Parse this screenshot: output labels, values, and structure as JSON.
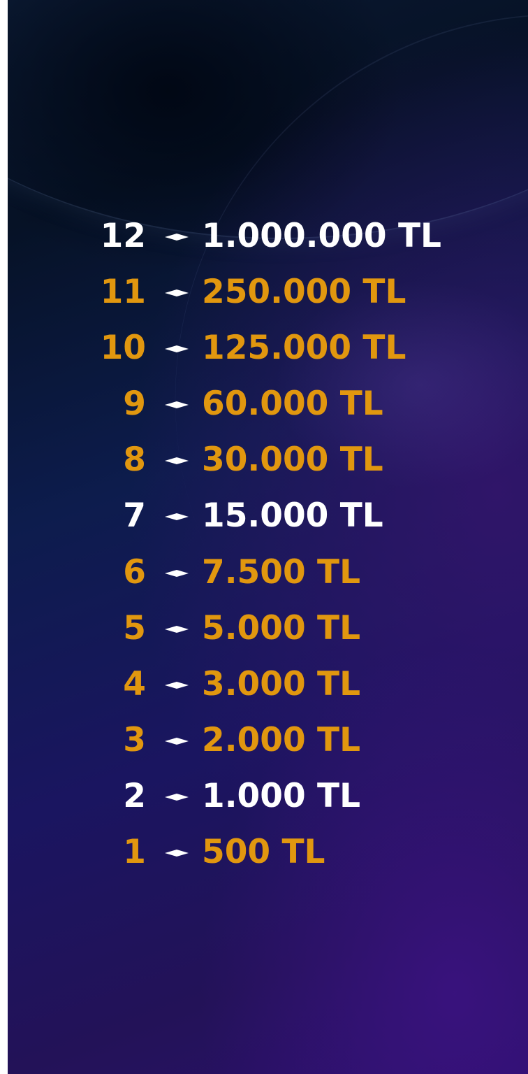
{
  "colors": {
    "safe_level": "#ffffff",
    "regular_level": "#e1970f",
    "marker": "#ffffff"
  },
  "money_ladder": [
    {
      "level": "12",
      "amount": "1.000.000 TL",
      "style": "white"
    },
    {
      "level": "11",
      "amount": "250.000 TL",
      "style": "gold"
    },
    {
      "level": "10",
      "amount": "125.000 TL",
      "style": "gold"
    },
    {
      "level": "9",
      "amount": "60.000 TL",
      "style": "gold"
    },
    {
      "level": "8",
      "amount": "30.000 TL",
      "style": "gold"
    },
    {
      "level": "7",
      "amount": "15.000 TL",
      "style": "white"
    },
    {
      "level": "6",
      "amount": "7.500 TL",
      "style": "gold"
    },
    {
      "level": "5",
      "amount": "5.000 TL",
      "style": "gold"
    },
    {
      "level": "4",
      "amount": "3.000 TL",
      "style": "gold"
    },
    {
      "level": "3",
      "amount": "2.000 TL",
      "style": "gold"
    },
    {
      "level": "2",
      "amount": "1.000 TL",
      "style": "white"
    },
    {
      "level": "1",
      "amount": "500 TL",
      "style": "gold"
    }
  ],
  "marker_icon": "diamond-bullet-icon"
}
